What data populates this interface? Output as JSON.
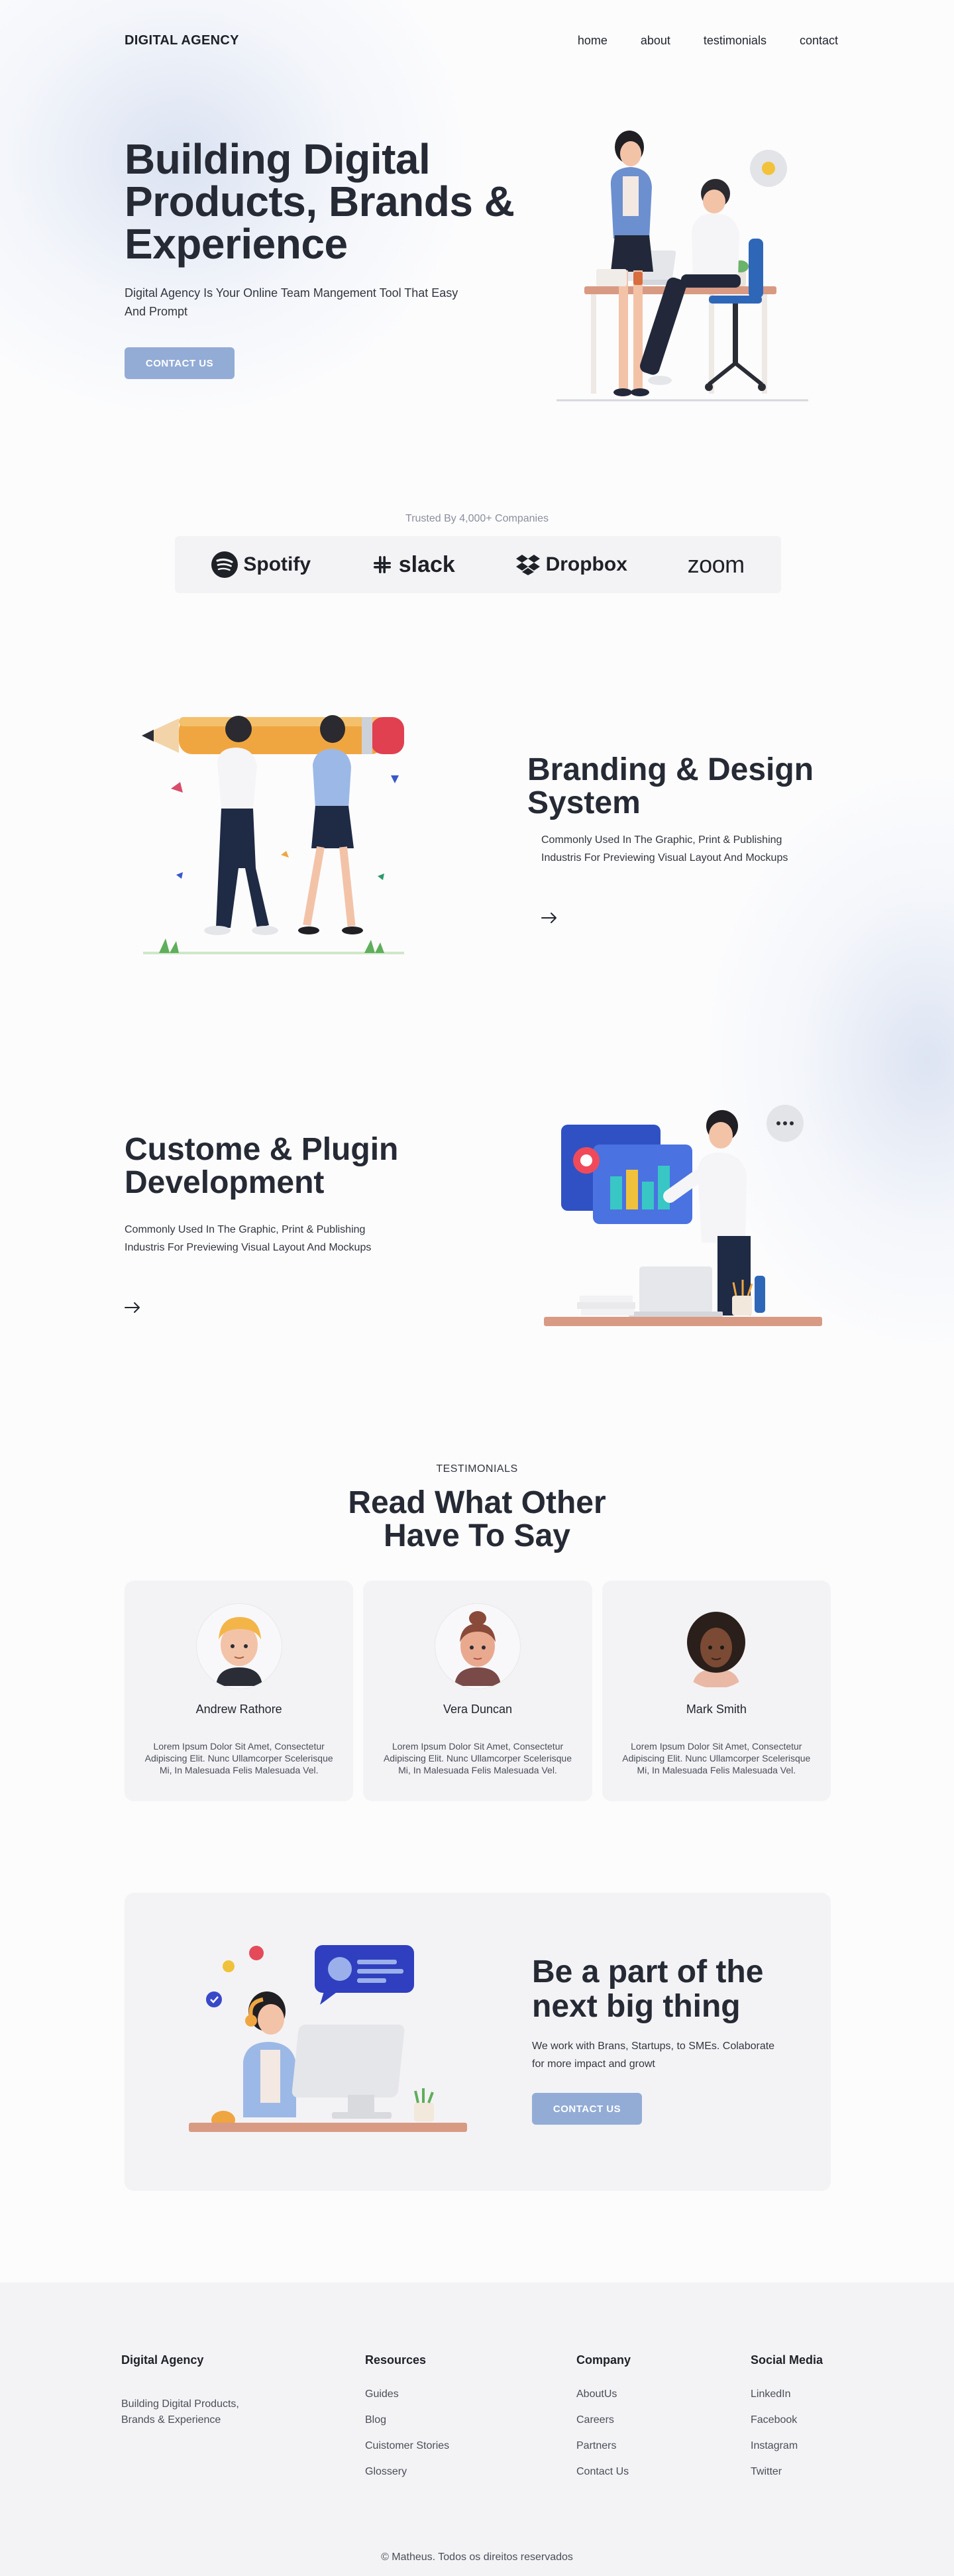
{
  "nav": {
    "logo": "DIGITAL AGENCY",
    "links": [
      "home",
      "about",
      "testimonials",
      "contact"
    ]
  },
  "hero": {
    "title": "Building Digital Products, Brands & Experience",
    "subtitle": "Digital Agency Is Your Online Team Mangement Tool That Easy And Prompt",
    "button": "CONTACT US"
  },
  "trusted": {
    "label": "Trusted By 4,000+ Companies",
    "brands": [
      "Spotify",
      "slack",
      "Dropbox",
      "zoom"
    ]
  },
  "feature_branding": {
    "title": "Branding & Design System",
    "text": "Commonly Used In The Graphic, Print & Publishing Industris For Previewing Visual Layout And Mockups"
  },
  "feature_plugin": {
    "title": "Custome & Plugin Development",
    "text": "Commonly Used In The Graphic, Print & Publishing Industris For Previewing Visual Layout And Mockups"
  },
  "testimonials": {
    "label": "TESTIMONIALS",
    "title": "Read What Other Have To Say",
    "items": [
      {
        "name": "Andrew Rathore",
        "text": "Lorem Ipsum Dolor Sit Amet, Consectetur Adipiscing Elit. Nunc Ullamcorper Scelerisque Mi, In Malesuada Felis Malesuada Vel."
      },
      {
        "name": "Vera Duncan",
        "text": "Lorem Ipsum Dolor Sit Amet, Consectetur Adipiscing Elit. Nunc Ullamcorper Scelerisque Mi, In Malesuada Felis Malesuada Vel."
      },
      {
        "name": "Mark Smith",
        "text": "Lorem Ipsum Dolor Sit Amet, Consectetur Adipiscing Elit. Nunc Ullamcorper Scelerisque Mi, In Malesuada Felis Malesuada Vel."
      }
    ]
  },
  "cta": {
    "title": "Be a part of the next big thing",
    "text": "We work with Brans, Startups, to SMEs. Colaborate for more impact and growt",
    "button": "CONTACT US"
  },
  "footer": {
    "brand": "Digital Agency",
    "about": "Building Digital Products, Brands & Experience",
    "columns": [
      {
        "title": "Resources",
        "links": [
          "Guides",
          "Blog",
          "Cuistomer Stories",
          "Glossery"
        ]
      },
      {
        "title": "Company",
        "links": [
          "AboutUs",
          "Careers",
          "Partners",
          "Contact Us"
        ]
      },
      {
        "title": "Social Media",
        "links": [
          "LinkedIn",
          "Facebook",
          "Instagram",
          "Twitter"
        ]
      }
    ],
    "copyright": "© Matheus. Todos os direitos reservados"
  },
  "colors": {
    "accent": "#93acd6",
    "text": "#262a35",
    "card_bg": "#f3f3f5"
  }
}
